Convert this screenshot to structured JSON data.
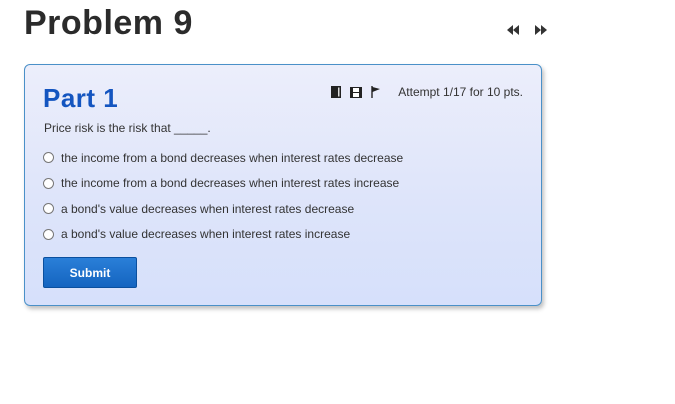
{
  "problem": {
    "title": "Problem 9"
  },
  "nav": {
    "prev_icon": "rewind-icon",
    "next_icon": "fast-forward-icon"
  },
  "part": {
    "title": "Part 1",
    "attempt_text": "Attempt 1/17 for 10 pts.",
    "tools": [
      "book-icon",
      "film-icon",
      "flag-icon"
    ],
    "question": "Price risk is the risk that _____.",
    "options": [
      "the income from a bond decreases when interest rates decrease",
      "the income from a bond decreases when interest rates increase",
      "a bond's value decreases when interest rates decrease",
      "a bond's value decreases when interest rates increase"
    ],
    "submit_label": "Submit"
  },
  "colors": {
    "part_title": "#1455c0",
    "card_border": "#4a90c8",
    "submit_bg": "#1464c0"
  }
}
